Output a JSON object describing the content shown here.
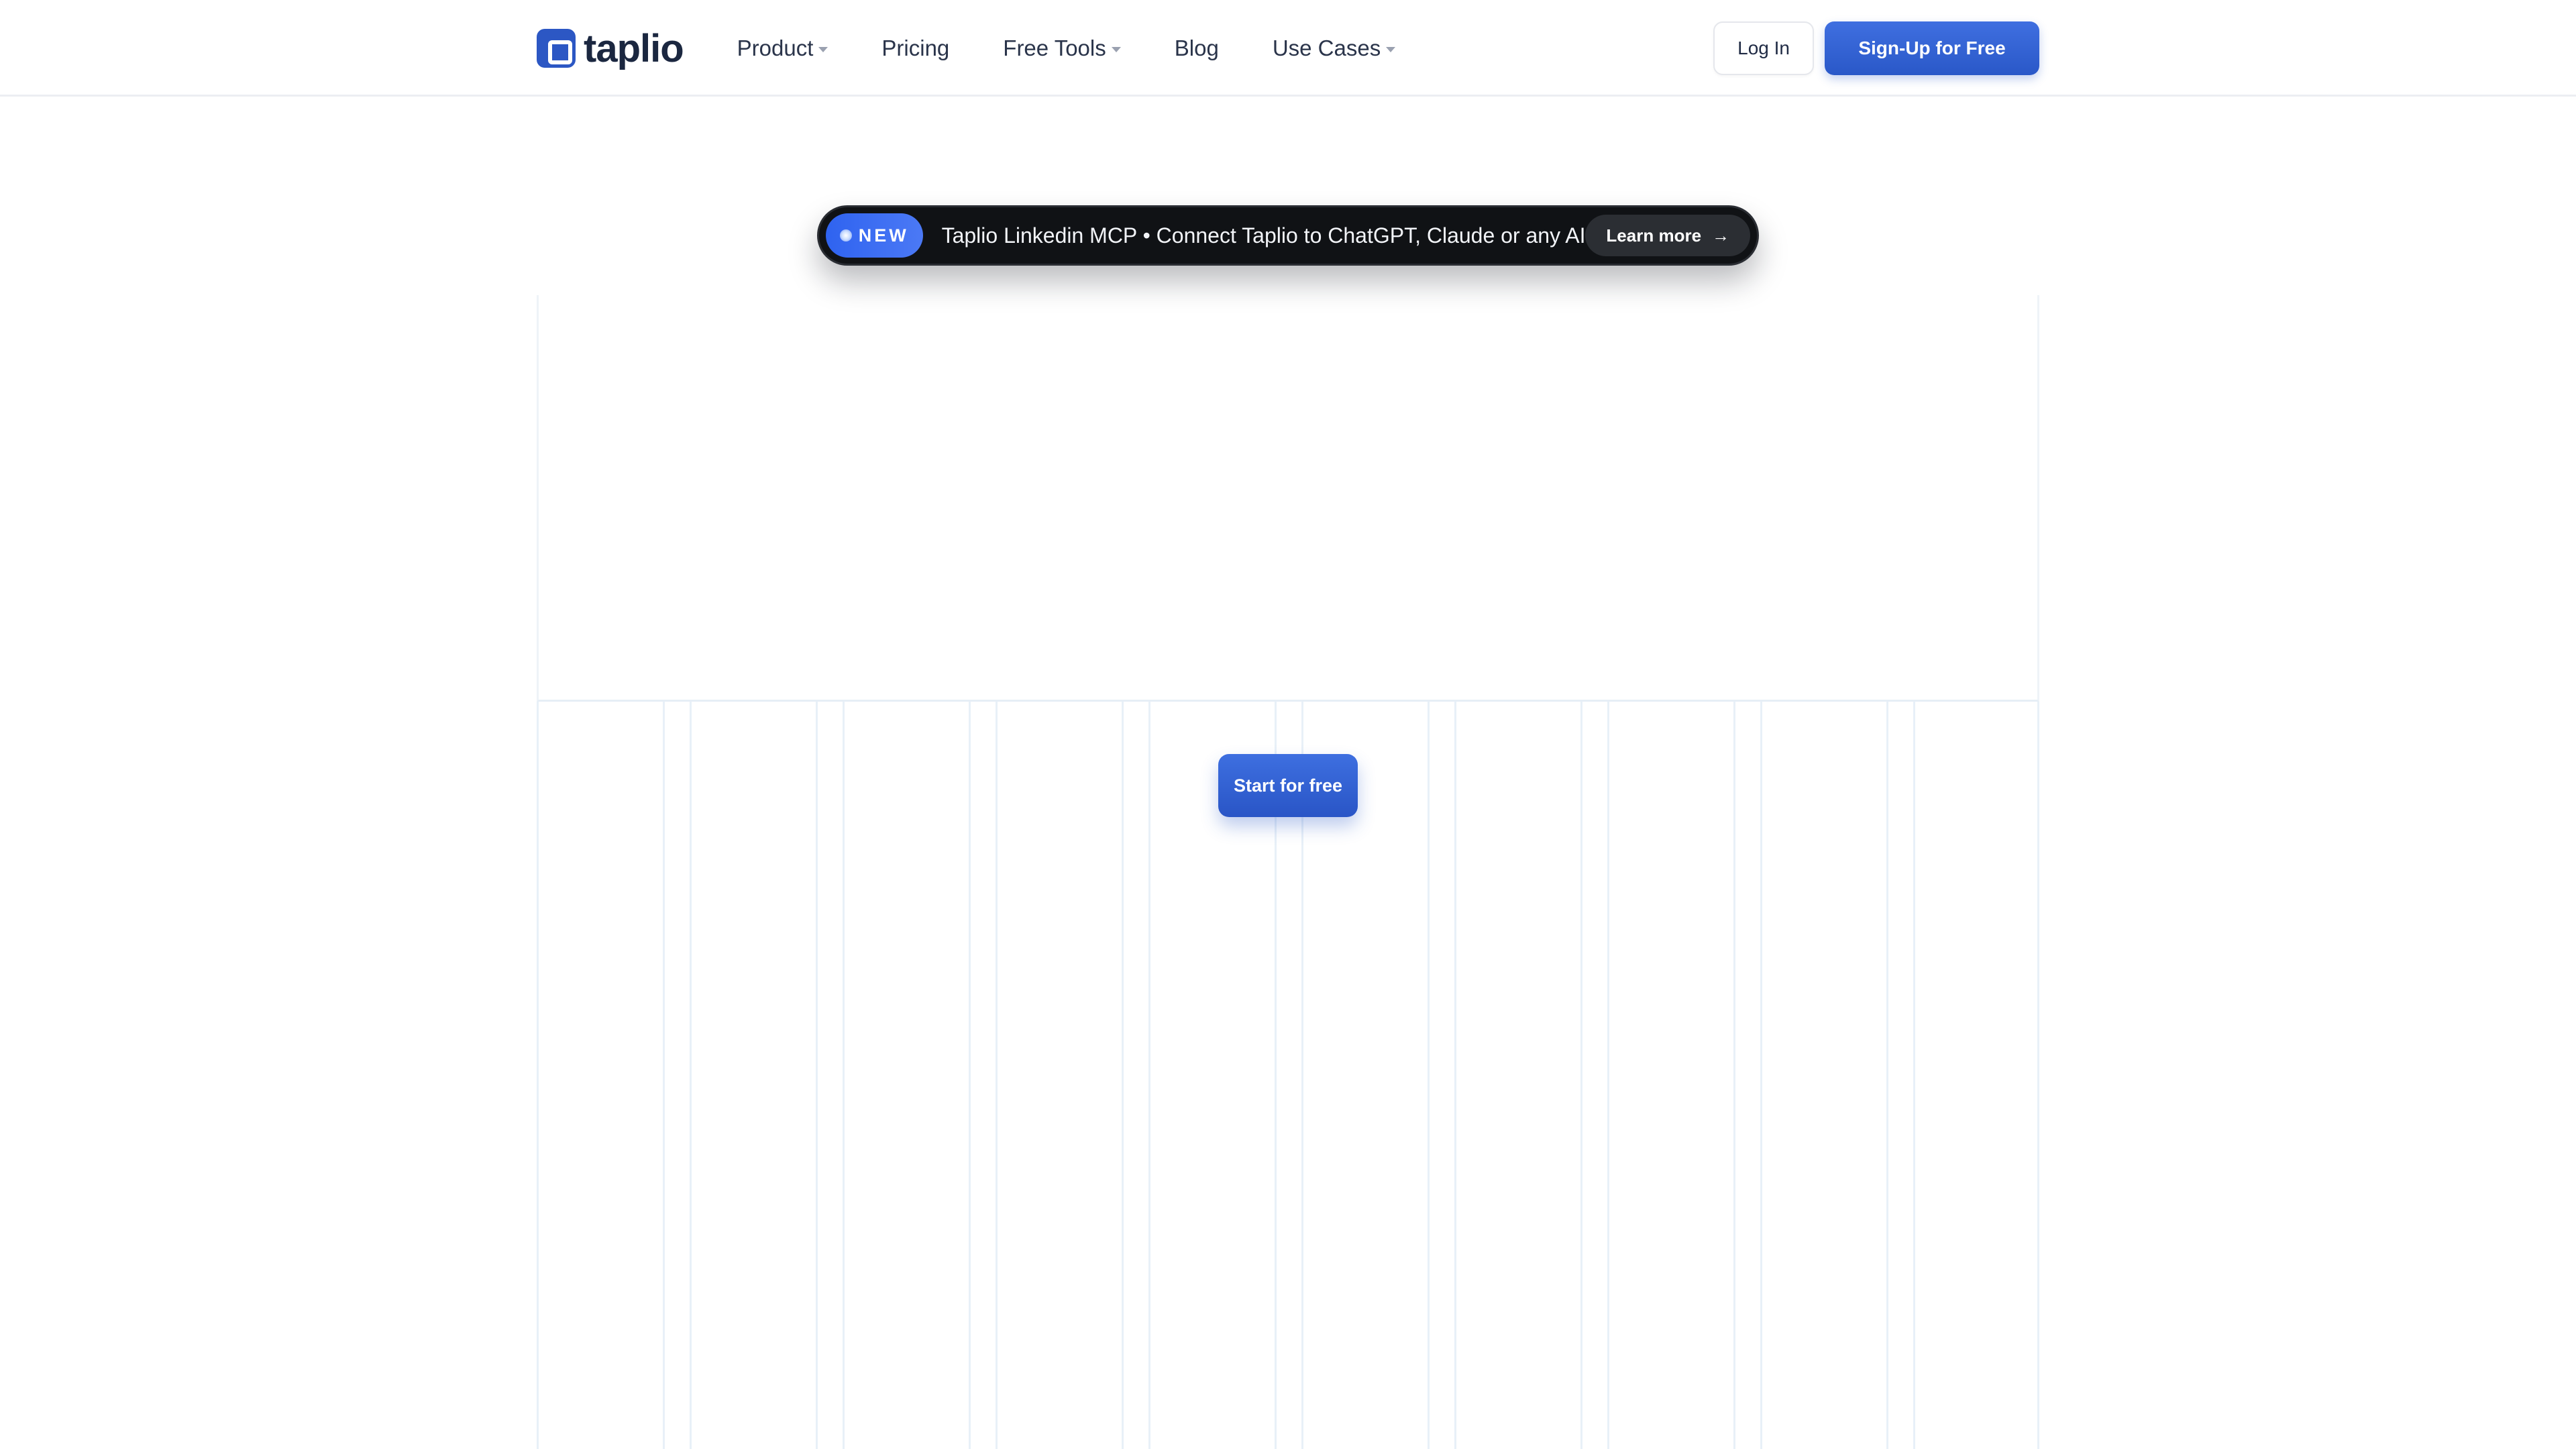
{
  "brand": {
    "name": "taplio",
    "logo_icon": "taplio-logo-icon",
    "color": "#2c57c4"
  },
  "nav": {
    "items": [
      {
        "label": "Product",
        "has_dropdown": true
      },
      {
        "label": "Pricing",
        "has_dropdown": false
      },
      {
        "label": "Free Tools",
        "has_dropdown": true
      },
      {
        "label": "Blog",
        "has_dropdown": false
      },
      {
        "label": "Use Cases",
        "has_dropdown": true
      }
    ],
    "login_label": "Log In",
    "signup_label": "Sign-Up for Free"
  },
  "announcement": {
    "badge": "NEW",
    "text": "Taplio Linkedin MCP • Connect Taplio to ChatGPT, Claude or any AI",
    "cta": "Learn more",
    "cta_icon": "arrow-right-icon"
  },
  "hero": {
    "cta_label": "Start for free"
  },
  "colors": {
    "primary": "#2c57c4",
    "announcement_bg": "#101215",
    "grid_line": "#e8f0f8"
  }
}
